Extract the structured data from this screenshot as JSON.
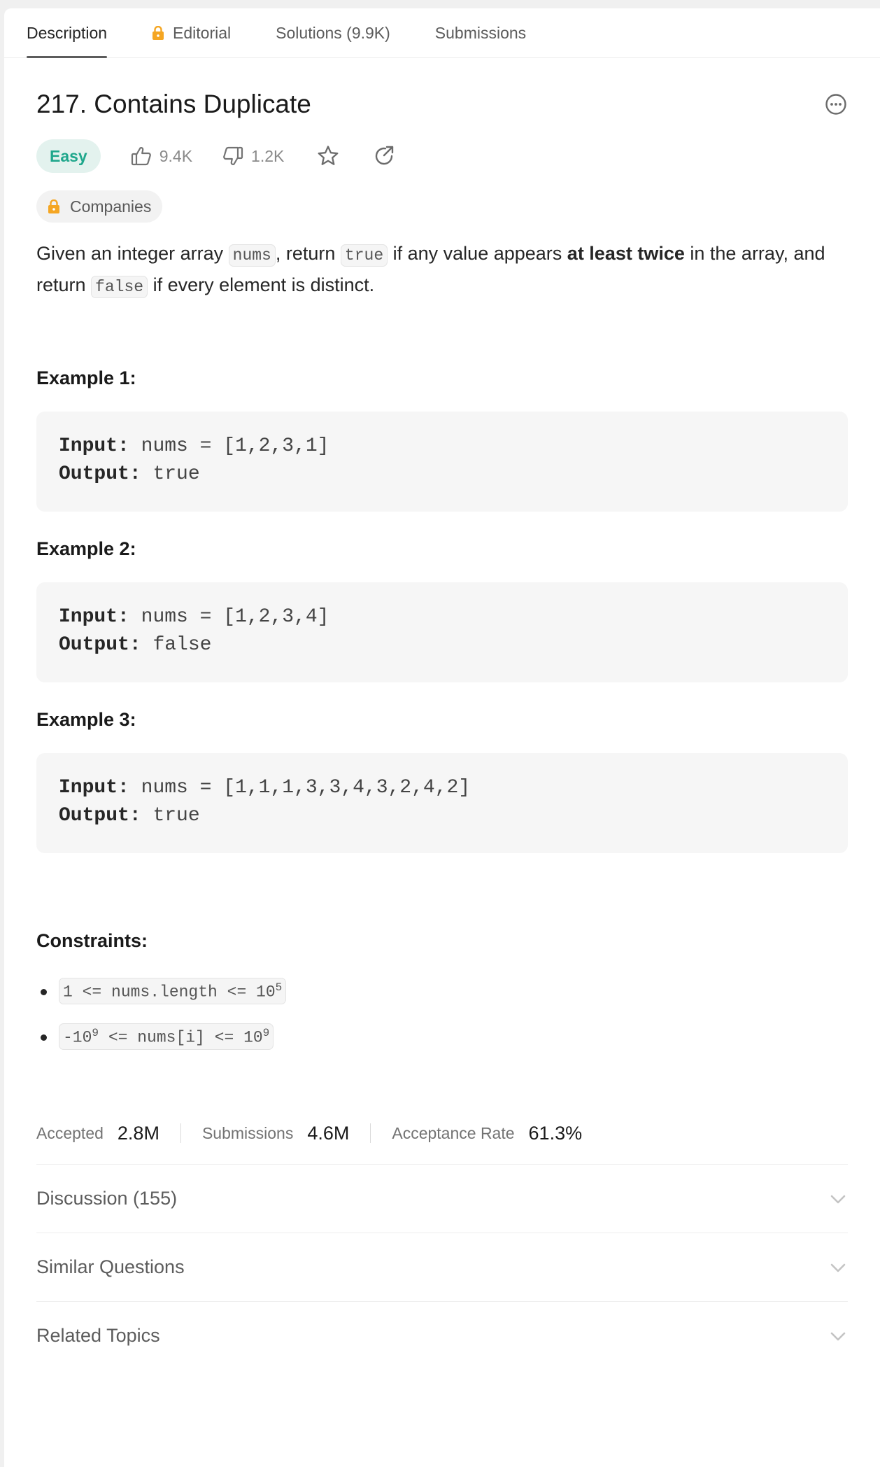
{
  "tabs": [
    {
      "label": "Description",
      "active": true
    },
    {
      "label": "Editorial",
      "locked": true
    },
    {
      "label": "Solutions (9.9K)"
    },
    {
      "label": "Submissions"
    }
  ],
  "problem": {
    "title": "217. Contains Duplicate",
    "difficulty": "Easy",
    "likes": "9.4K",
    "dislikes": "1.2K",
    "companies_label": "Companies"
  },
  "description": {
    "p1": "Given an integer array ",
    "c1": "nums",
    "p2": ", return ",
    "c2": "true",
    "p3": " if any value appears ",
    "b1": "at least twice",
    "p4": " in the array, and return ",
    "c3": "false",
    "p5": " if every element is distinct."
  },
  "examples": [
    {
      "title": "Example 1:",
      "input_label": "Input:",
      "input": "nums = [1,2,3,1]",
      "output_label": "Output:",
      "output": "true"
    },
    {
      "title": "Example 2:",
      "input_label": "Input:",
      "input": "nums = [1,2,3,4]",
      "output_label": "Output:",
      "output": "false"
    },
    {
      "title": "Example 3:",
      "input_label": "Input:",
      "input": "nums = [1,1,1,3,3,4,3,2,4,2]",
      "output_label": "Output:",
      "output": "true"
    }
  ],
  "constraints": {
    "title": "Constraints:",
    "c1_pre": "1 <= nums.length <= 10",
    "c1_sup": "5",
    "c2_a": "-10",
    "c2_sup1": "9",
    "c2_b": " <= nums[i] <= 10",
    "c2_sup2": "9"
  },
  "stats": {
    "accepted_label": "Accepted",
    "accepted": "2.8M",
    "submissions_label": "Submissions",
    "submissions": "4.6M",
    "rate_label": "Acceptance Rate",
    "rate": "61.3%"
  },
  "sections": [
    {
      "label": "Discussion (155)"
    },
    {
      "label": "Similar Questions"
    },
    {
      "label": "Related Topics"
    }
  ],
  "colors": {
    "easy": "#1fa78c",
    "lock": "#f5a623"
  }
}
